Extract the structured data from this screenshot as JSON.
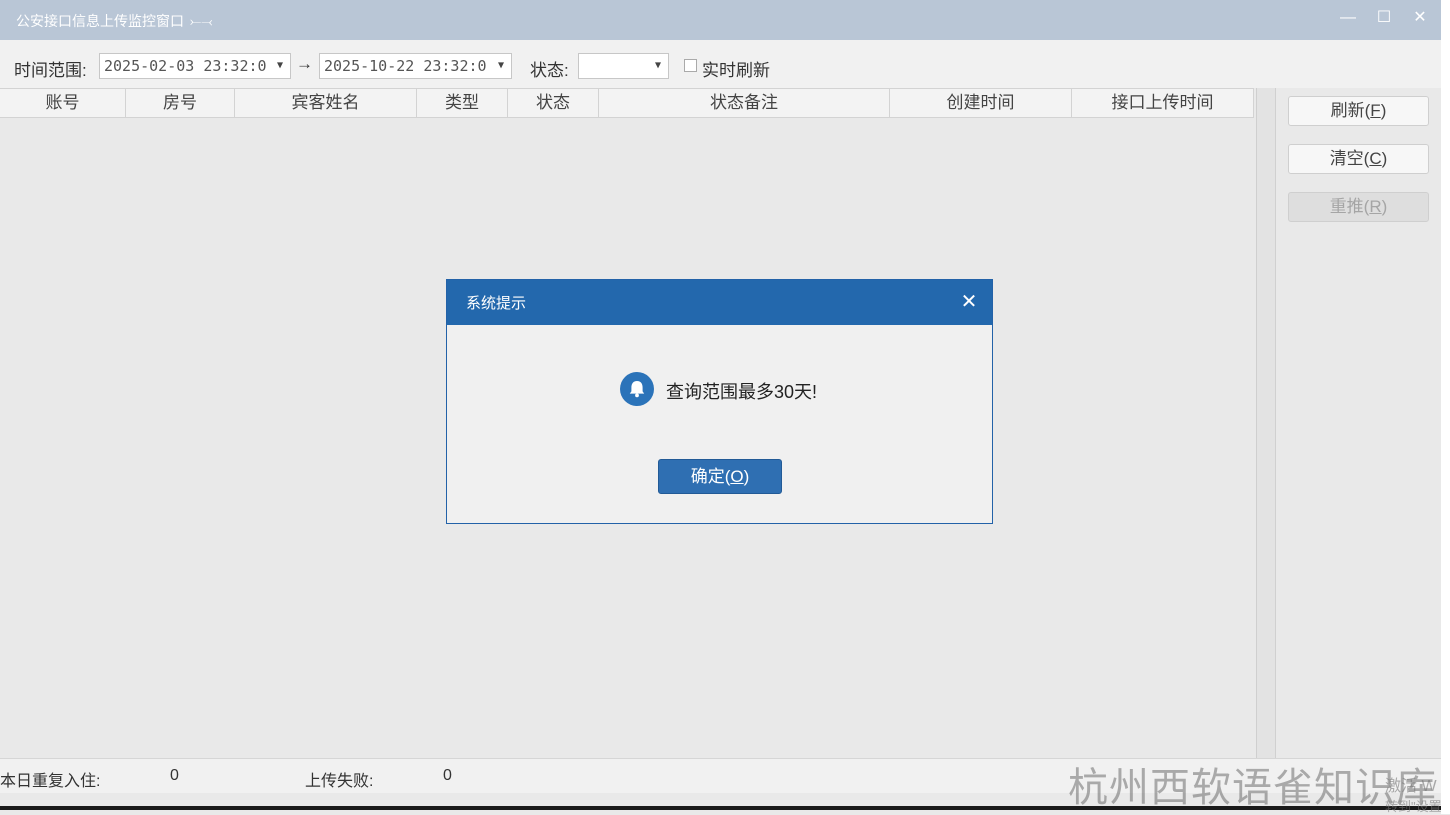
{
  "window": {
    "title": "公安接口信息上传监控窗口",
    "title_extra": "⤚⤙",
    "minimize_glyph": "—",
    "maximize_glyph": "☐",
    "close_glyph": "✕"
  },
  "filters": {
    "time_range_label": "时间范围:",
    "start_time": "2025-02-03 23:32:0",
    "range_arrow": "→",
    "end_time": "2025-10-22 23:32:0",
    "status_label": "状态:",
    "status_value": "",
    "realtime_refresh_label": "实时刷新",
    "realtime_refresh_checked": false
  },
  "table": {
    "columns": [
      "账号",
      "房号",
      "宾客姓名",
      "类型",
      "状态",
      "状态备注",
      "创建时间",
      "接口上传时间"
    ],
    "rows": []
  },
  "side_buttons": {
    "refresh": {
      "label": "刷新(",
      "key": "F",
      "end": ")"
    },
    "clear": {
      "label": "清空(",
      "key": "C",
      "end": ")"
    },
    "repush": {
      "label": "重推(",
      "key": "R",
      "end": ")"
    }
  },
  "statusbar": {
    "repeat_checkin_label": "本日重复入住:",
    "repeat_checkin_value": "0",
    "upload_fail_label": "上传失败:",
    "upload_fail_value": "0"
  },
  "watermark": {
    "main": "杭州西软语雀知识库",
    "line1": "激活 W",
    "line2": "转到\"设置"
  },
  "dialog": {
    "title": "系统提示",
    "close_glyph": "✕",
    "message": "查询范围最多30天!",
    "ok": {
      "label": "确定(",
      "key": "O",
      "end": ")"
    }
  },
  "colors": {
    "titlebar": "#b9c6d6",
    "dialog_header": "#2368ad",
    "ok_button": "#2f6fb2",
    "bell_icon": "#2b73b9"
  }
}
